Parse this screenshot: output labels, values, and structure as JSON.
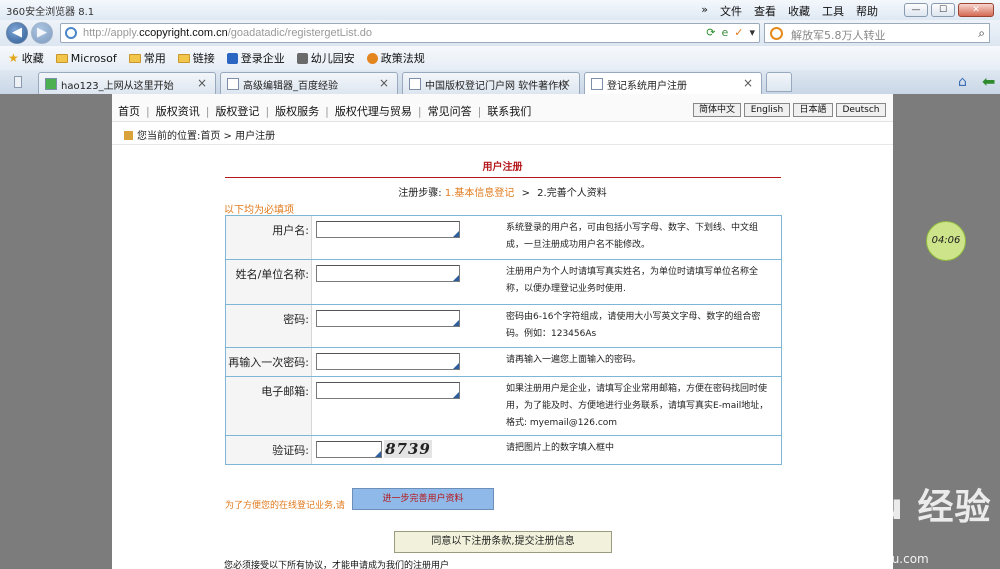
{
  "browser": {
    "title": "360安全浏览器 8.1",
    "menu": [
      "»",
      "文件",
      "查看",
      "收藏",
      "工具",
      "帮助"
    ],
    "window_controls": [
      "—",
      "☐",
      "✕"
    ],
    "url_prefix": "http://apply.",
    "url_domain": "ccopyright.com.cn",
    "url_suffix": "/goadatadic/registergetList.do",
    "search_placeholder": "解放军5.8万人转业",
    "bookmarks": [
      {
        "label": "收藏",
        "icon": "star-icon"
      },
      {
        "label": "Microsof",
        "icon": "folder-icon"
      },
      {
        "label": "常用",
        "icon": "folder-icon"
      },
      {
        "label": "链接",
        "icon": "folder-icon"
      },
      {
        "label": "登录企业",
        "icon": "app-icon"
      },
      {
        "label": "幼儿园安",
        "icon": "app-icon"
      },
      {
        "label": "政策法规",
        "icon": "app-icon"
      }
    ],
    "tabs": [
      {
        "label": "hao123_上网从这里开始"
      },
      {
        "label": "高级编辑器_百度经验"
      },
      {
        "label": "中国版权登记门户网 软件著作权"
      },
      {
        "label": "登记系统用户注册"
      }
    ]
  },
  "site": {
    "nav": [
      "首页",
      "版权资讯",
      "版权登记",
      "版权服务",
      "版权代理与贸易",
      "常见问答",
      "联系我们"
    ],
    "languages": [
      "简体中文",
      "English",
      "日本語",
      "Deutsch"
    ],
    "breadcrumb": "您当前的位置:首页 > 用户注册"
  },
  "form": {
    "title": "用户注册",
    "steps_label": "注册步骤:",
    "step1": "1.基本信息登记",
    "step_sep": ">",
    "step2": "2.完善个人资料",
    "required_note": "以下均为必填项",
    "rows": [
      {
        "label": "用户名:",
        "hint": "系统登录的用户名，可由包括小写字母、数字、下划线、中文组成，一旦注册成功用户名不能修改。"
      },
      {
        "label": "姓名/单位名称:",
        "hint": "注册用户为个人时请填写真实姓名，为单位时请填写单位名称全称，以便办理登记业务时使用."
      },
      {
        "label": "密码:",
        "hint": "密码由6-16个字符组成，请使用大小写英文字母、数字的组合密码。例如：123456As"
      },
      {
        "label": "再输入一次密码:",
        "hint": "请再输入一遍您上面输入的密码。"
      },
      {
        "label": "电子邮箱:",
        "hint": "如果注册用户是企业，请填写企业常用邮箱，方便在密码找回时使用，为了能及时、方便地进行业务联系，请填写真实E-mail地址，格式: myemail@126.com"
      },
      {
        "label": "验证码:",
        "hint": "请把图片上的数字填入框中"
      }
    ],
    "captcha": "8739",
    "next_note": "为了方便您的在线登记业务,请",
    "next_button": "进一步完善用户资料",
    "agree_button": "同意以下注册条款,提交注册信息",
    "footer_note": "您必须接受以下所有协议，才能申请成为我们的注册用户"
  },
  "timer": "04:06",
  "watermark": {
    "main": "Bai du 经验",
    "sub": "jingyan.baidu.com"
  }
}
